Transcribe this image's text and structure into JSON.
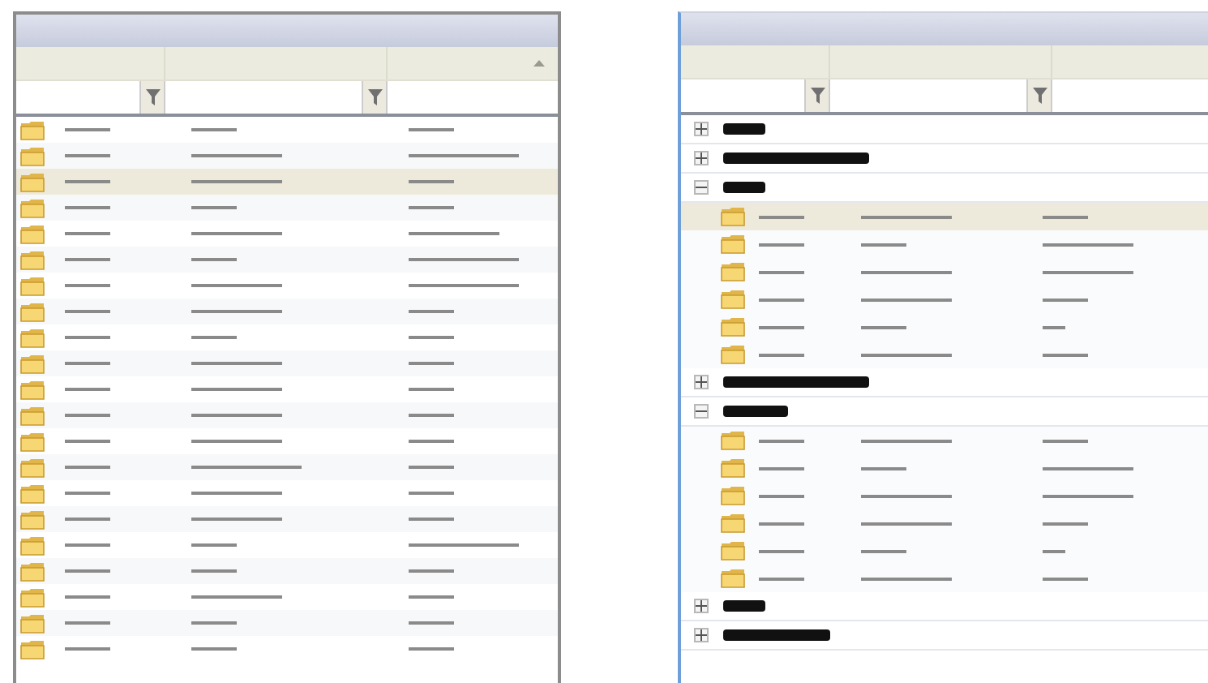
{
  "left_grid": {
    "sorted_column_ascending": true,
    "rows": [
      {
        "selected": false,
        "cells": [
          {
            "kind": "short"
          },
          {
            "kind": "short"
          },
          {
            "kind": "short"
          }
        ]
      },
      {
        "selected": false,
        "cells": [
          {
            "kind": "short"
          },
          {
            "kind": "medium"
          },
          {
            "kind": "long"
          }
        ]
      },
      {
        "selected": true,
        "cells": [
          {
            "kind": "short"
          },
          {
            "kind": "medium"
          },
          {
            "kind": "short"
          }
        ]
      },
      {
        "selected": false,
        "cells": [
          {
            "kind": "short"
          },
          {
            "kind": "short"
          },
          {
            "kind": "short"
          }
        ]
      },
      {
        "selected": false,
        "cells": [
          {
            "kind": "short"
          },
          {
            "kind": "medium"
          },
          {
            "kind": "medium"
          }
        ]
      },
      {
        "selected": false,
        "cells": [
          {
            "kind": "short"
          },
          {
            "kind": "short"
          },
          {
            "kind": "long"
          }
        ]
      },
      {
        "selected": false,
        "cells": [
          {
            "kind": "short"
          },
          {
            "kind": "medium"
          },
          {
            "kind": "long"
          }
        ]
      },
      {
        "selected": false,
        "cells": [
          {
            "kind": "short"
          },
          {
            "kind": "medium"
          },
          {
            "kind": "short"
          }
        ]
      },
      {
        "selected": false,
        "cells": [
          {
            "kind": "short"
          },
          {
            "kind": "short"
          },
          {
            "kind": "short"
          }
        ]
      },
      {
        "selected": false,
        "cells": [
          {
            "kind": "short"
          },
          {
            "kind": "medium"
          },
          {
            "kind": "short"
          }
        ]
      },
      {
        "selected": false,
        "cells": [
          {
            "kind": "short"
          },
          {
            "kind": "medium"
          },
          {
            "kind": "short"
          }
        ]
      },
      {
        "selected": false,
        "cells": [
          {
            "kind": "short"
          },
          {
            "kind": "medium"
          },
          {
            "kind": "short"
          }
        ]
      },
      {
        "selected": false,
        "cells": [
          {
            "kind": "short"
          },
          {
            "kind": "medium"
          },
          {
            "kind": "short"
          }
        ]
      },
      {
        "selected": false,
        "cells": [
          {
            "kind": "short"
          },
          {
            "kind": "long"
          },
          {
            "kind": "short"
          }
        ]
      },
      {
        "selected": false,
        "cells": [
          {
            "kind": "short"
          },
          {
            "kind": "medium"
          },
          {
            "kind": "short"
          }
        ]
      },
      {
        "selected": false,
        "cells": [
          {
            "kind": "short"
          },
          {
            "kind": "medium"
          },
          {
            "kind": "short"
          }
        ]
      },
      {
        "selected": false,
        "cells": [
          {
            "kind": "short"
          },
          {
            "kind": "short"
          },
          {
            "kind": "long"
          }
        ]
      },
      {
        "selected": false,
        "cells": [
          {
            "kind": "short"
          },
          {
            "kind": "short"
          },
          {
            "kind": "short"
          }
        ]
      },
      {
        "selected": false,
        "cells": [
          {
            "kind": "short"
          },
          {
            "kind": "medium"
          },
          {
            "kind": "short"
          }
        ]
      },
      {
        "selected": false,
        "cells": [
          {
            "kind": "short"
          },
          {
            "kind": "short"
          },
          {
            "kind": "short"
          }
        ]
      },
      {
        "selected": false,
        "cells": [
          {
            "kind": "short"
          },
          {
            "kind": "short"
          },
          {
            "kind": "short"
          }
        ]
      }
    ]
  },
  "right_grid": {
    "groups": [
      {
        "label": {
          "kind": "short"
        },
        "expanded": false
      },
      {
        "label": {
          "kind": "huge"
        },
        "expanded": false
      },
      {
        "label": {
          "kind": "short"
        },
        "expanded": true,
        "rows": [
          {
            "selected": true,
            "cells": [
              {
                "kind": "short"
              },
              {
                "kind": "medium"
              },
              {
                "kind": "short"
              }
            ]
          },
          {
            "selected": false,
            "cells": [
              {
                "kind": "short"
              },
              {
                "kind": "short"
              },
              {
                "kind": "medium"
              }
            ]
          },
          {
            "selected": false,
            "cells": [
              {
                "kind": "short"
              },
              {
                "kind": "medium"
              },
              {
                "kind": "medium"
              }
            ]
          },
          {
            "selected": false,
            "cells": [
              {
                "kind": "short"
              },
              {
                "kind": "medium"
              },
              {
                "kind": "short"
              }
            ]
          },
          {
            "selected": false,
            "cells": [
              {
                "kind": "short"
              },
              {
                "kind": "short"
              },
              {
                "kind": "tiny"
              }
            ]
          },
          {
            "selected": false,
            "cells": [
              {
                "kind": "short"
              },
              {
                "kind": "medium"
              },
              {
                "kind": "short"
              }
            ]
          }
        ]
      },
      {
        "label": {
          "kind": "huge"
        },
        "expanded": false
      },
      {
        "label": {
          "kind": "medium"
        },
        "expanded": true,
        "rows": [
          {
            "selected": false,
            "cells": [
              {
                "kind": "short"
              },
              {
                "kind": "medium"
              },
              {
                "kind": "short"
              }
            ]
          },
          {
            "selected": false,
            "cells": [
              {
                "kind": "short"
              },
              {
                "kind": "short"
              },
              {
                "kind": "medium"
              }
            ]
          },
          {
            "selected": false,
            "cells": [
              {
                "kind": "short"
              },
              {
                "kind": "medium"
              },
              {
                "kind": "medium"
              }
            ]
          },
          {
            "selected": false,
            "cells": [
              {
                "kind": "short"
              },
              {
                "kind": "medium"
              },
              {
                "kind": "short"
              }
            ]
          },
          {
            "selected": false,
            "cells": [
              {
                "kind": "short"
              },
              {
                "kind": "short"
              },
              {
                "kind": "tiny"
              }
            ]
          },
          {
            "selected": false,
            "cells": [
              {
                "kind": "short"
              },
              {
                "kind": "medium"
              },
              {
                "kind": "short"
              }
            ]
          }
        ]
      },
      {
        "label": {
          "kind": "short"
        },
        "expanded": false
      },
      {
        "label": {
          "kind": "long"
        },
        "expanded": false
      }
    ]
  }
}
